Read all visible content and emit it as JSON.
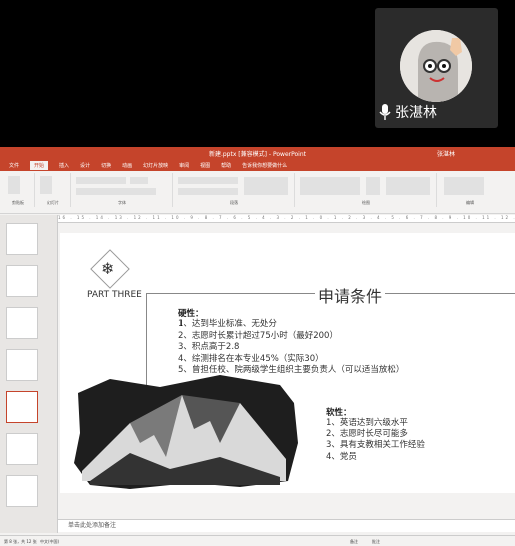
{
  "meeting": {
    "participant_name": "张湛林"
  },
  "powerpoint": {
    "window_title": "新建.pptx [兼容模式] - PowerPoint",
    "user_label": "张湛林",
    "tabs": [
      "文件",
      "开始",
      "插入",
      "设计",
      "切换",
      "动画",
      "幻灯片放映",
      "审阅",
      "视图",
      "帮助",
      "告诉我你想要做什么"
    ],
    "ribbon_groups": [
      "剪贴板",
      "幻灯片",
      "字体",
      "段落",
      "绘图",
      "编辑"
    ],
    "ruler_text": "16 . 15 . 14 . 13 . 12 . 11 . 10 . 9 . 8 . 7 . 6 . 5 . 4 . 3 . 2 . 1 . 0 . 1 . 2 . 3 . 4 . 5 . 6 . 7 . 8 . 9 . 10 . 11 . 12 . 13 . 14 . 15 . 16",
    "notes_placeholder": "单击此处添加备注",
    "status": {
      "slide_info": "第 8 张，共 12 张",
      "language": "中文(中国)",
      "notes_btn": "备注",
      "comments_btn": "批注"
    }
  },
  "slide": {
    "section_label": "PART THREE",
    "title": "申请条件",
    "hard_heading": "硬性：",
    "hard_items": [
      "1、达到毕业标准、无处分",
      "2、志愿时长累计超过75小时（最好200）",
      "3、积点高于2.8",
      "4、综测排名在本专业45%（实际30）",
      "5、曾担任校、院两级学生组织主要负责人（可以适当放松）"
    ],
    "soft_heading": "软性：",
    "soft_items": [
      "1、英语达到六级水平",
      "2、志愿时长尽可能多",
      "3、具有支教相关工作经验",
      "4、党员"
    ]
  },
  "colors": {
    "ppt_accent": "#c5442b",
    "background": "#000000"
  }
}
